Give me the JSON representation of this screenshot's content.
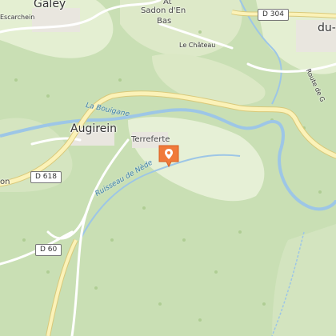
{
  "map": {
    "labels": {
      "galey": "Galey",
      "sadon": "Sadon d'En",
      "bas": "Bas",
      "le_chateau": "Le Château",
      "augirein": "Augirein",
      "terreferte": "Terreferte",
      "la_bouigane": "La Bouigane",
      "ruisseau": "Ruisseau de Nède",
      "du": "du-",
      "route": "Route de G",
      "scarchein": "Escarchein",
      "at": "At",
      "on": "on"
    },
    "roads": {
      "d304": "D 304",
      "d618": "D 618",
      "d60": "D 60"
    },
    "colors": {
      "forest": "#c9dfb4",
      "meadow": "#e4efd2",
      "water": "#9dc6e6",
      "main_road": "#fbf2b8",
      "marker": "#f07a3a"
    },
    "marker_icon": "location-pin-icon"
  }
}
